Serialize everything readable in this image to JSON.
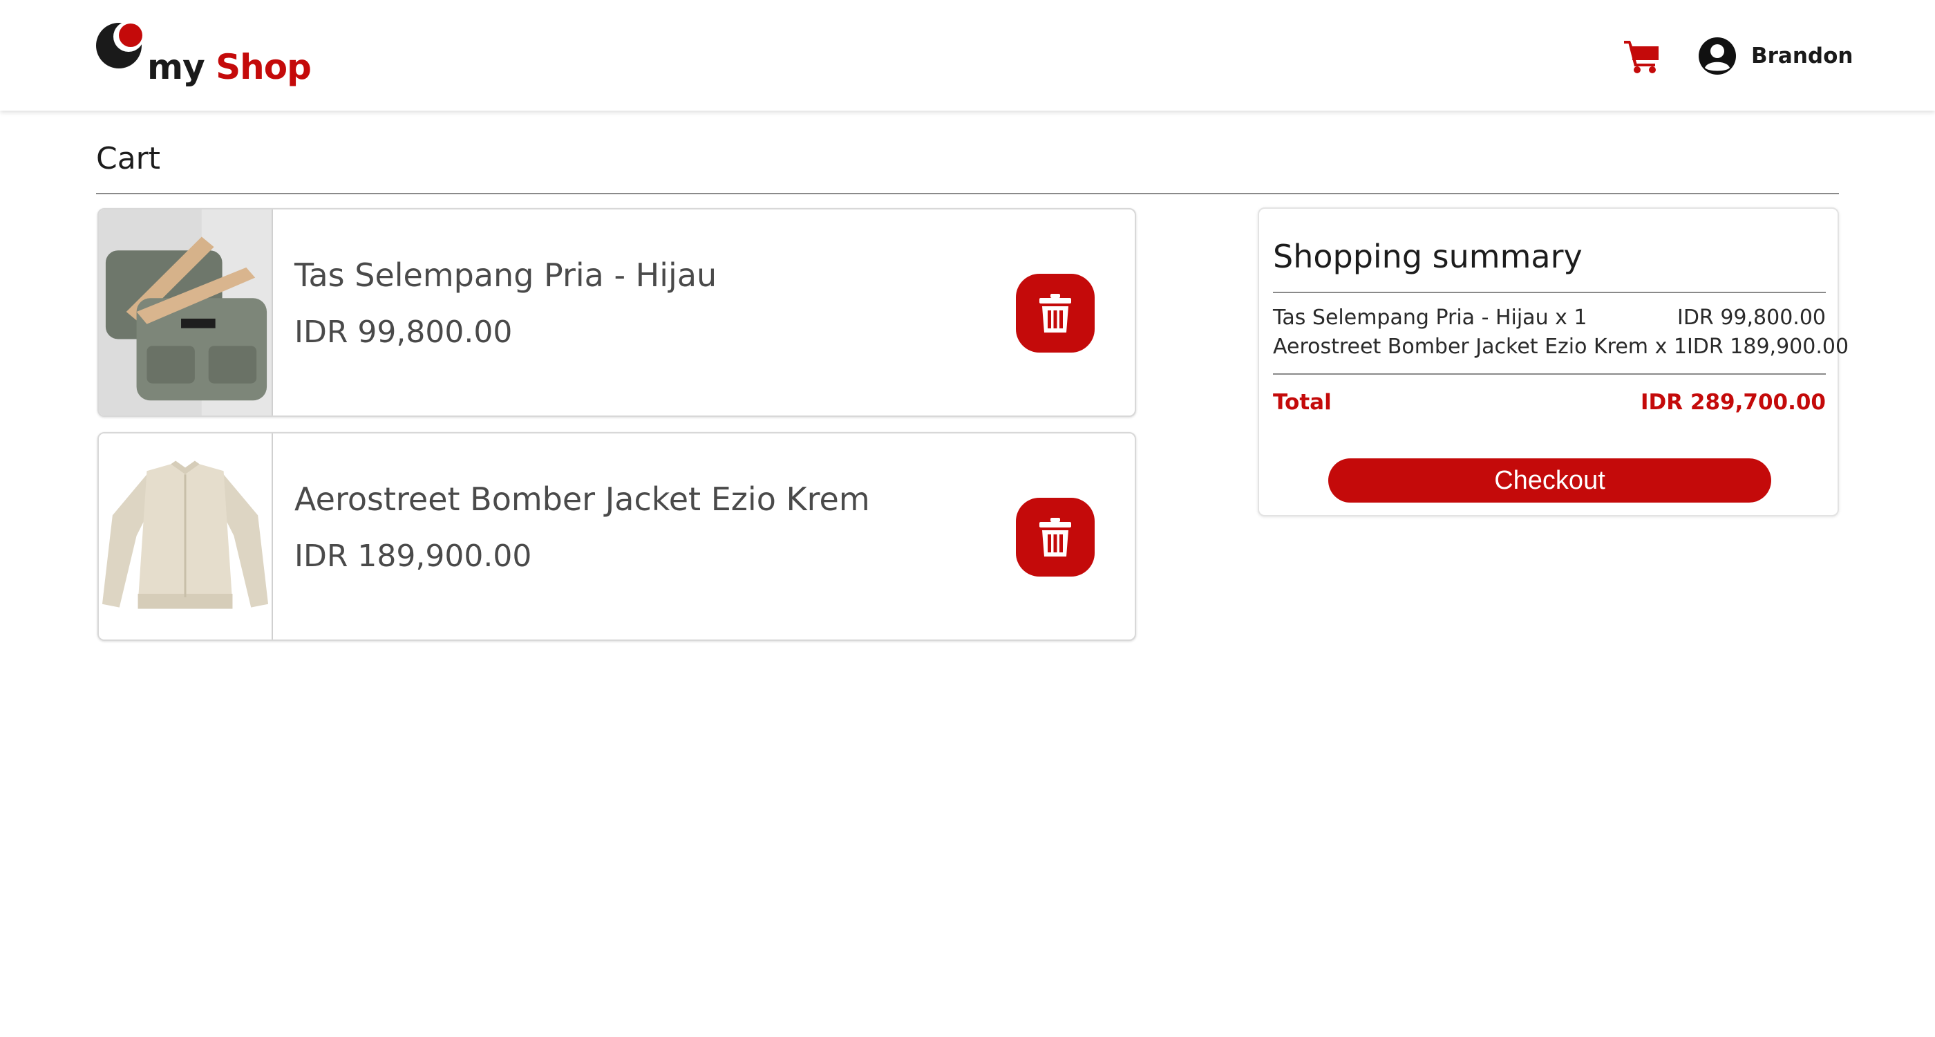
{
  "brand": {
    "name_part1": "my",
    "name_part2": "Shop",
    "accent_color": "#c40a0a"
  },
  "header": {
    "cart_icon": "shopping-cart-icon",
    "user_icon": "user-circle-icon",
    "user_name": "Brandon"
  },
  "page": {
    "title": "Cart"
  },
  "cart": {
    "items": [
      {
        "name": "Tas Selempang Pria - Hijau",
        "price": "IDR 99,800.00",
        "image_icon": "bag-product-image",
        "delete_icon": "trash-icon"
      },
      {
        "name": "Aerostreet Bomber Jacket Ezio Krem",
        "price": "IDR 189,900.00",
        "image_icon": "jacket-product-image",
        "delete_icon": "trash-icon"
      }
    ]
  },
  "summary": {
    "title": "Shopping summary",
    "rows": [
      {
        "label": "Tas Selempang Pria - Hijau x 1",
        "amount": "IDR 99,800.00"
      },
      {
        "label": "Aerostreet Bomber Jacket Ezio Krem x 1",
        "amount": "IDR 189,900.00"
      }
    ],
    "total_label": "Total",
    "total_amount": "IDR 289,700.00",
    "checkout_label": "Checkout"
  }
}
